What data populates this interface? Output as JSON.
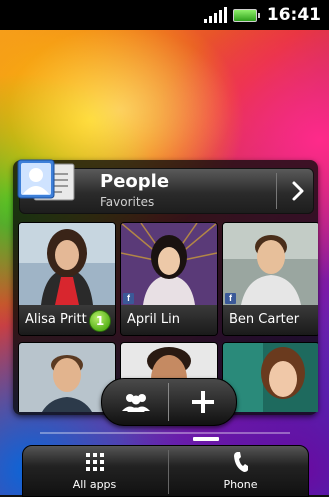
{
  "status_bar": {
    "time": "16:41",
    "signal_icon": "signal-bars-icon",
    "battery_icon": "battery-icon"
  },
  "people_widget": {
    "title": "People",
    "subtitle": "Favorites",
    "contacts": [
      {
        "name": "Alisa Pritt",
        "facebook": false,
        "badge": "1"
      },
      {
        "name": "April Lin",
        "facebook": true,
        "badge": ""
      },
      {
        "name": "Ben Carter",
        "facebook": true,
        "badge": ""
      },
      {
        "name": "",
        "facebook": false,
        "badge": ""
      },
      {
        "name": "",
        "facebook": false,
        "badge": ""
      },
      {
        "name": "",
        "facebook": false,
        "badge": ""
      }
    ]
  },
  "quick_actions": {
    "groups_icon": "people-group-icon",
    "add_icon": "plus-icon"
  },
  "dock": {
    "all_apps_label": "All apps",
    "phone_label": "Phone"
  },
  "colors": {
    "facebook": "#3b5998",
    "badge_green": "#58b21c"
  }
}
